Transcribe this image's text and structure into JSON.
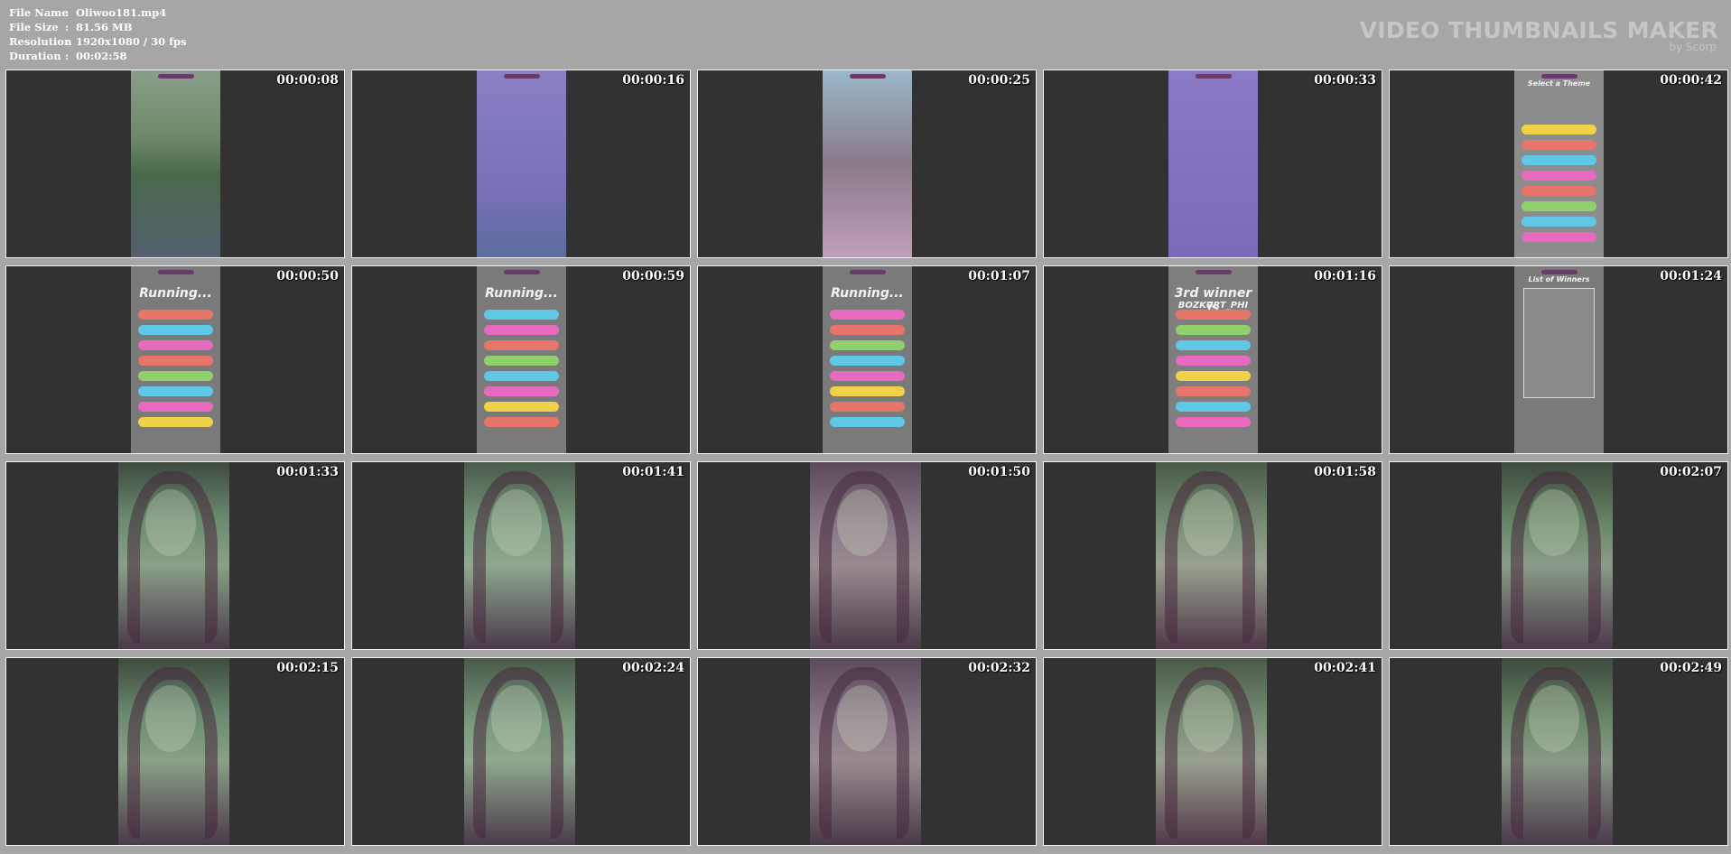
{
  "info": {
    "rows": [
      {
        "label": "File Name",
        "value": "Oliwoo181.mp4"
      },
      {
        "label": "File Size",
        "value": "81.56 MB"
      },
      {
        "label": "Resolution",
        "value": "1920x1080 / 30 fps"
      },
      {
        "label": "Duration",
        "value": "00:02:58"
      }
    ],
    "separator": ":"
  },
  "brand": {
    "title": "VIDEO THUMBNAILS MAKER",
    "subtitle": "by Scorp"
  },
  "colors": {
    "background": "#a6a6a6",
    "cell": "#323232",
    "border": "#f2f2f2"
  },
  "thumbnails": [
    {
      "time": "00:00:08",
      "kind": "movie"
    },
    {
      "time": "00:00:16",
      "kind": "puzzle"
    },
    {
      "time": "00:00:25",
      "kind": "game-room"
    },
    {
      "time": "00:00:33",
      "kind": "app-promo"
    },
    {
      "time": "00:00:42",
      "kind": "theme-select",
      "caption": "Select a Theme"
    },
    {
      "time": "00:00:50",
      "kind": "running",
      "caption": "Running..."
    },
    {
      "time": "00:00:59",
      "kind": "running",
      "caption": "Running..."
    },
    {
      "time": "00:01:07",
      "kind": "running",
      "caption": "Running..."
    },
    {
      "time": "00:01:16",
      "kind": "winner",
      "caption": "3rd winner is",
      "caption2": "BOZKURT_PHI"
    },
    {
      "time": "00:01:24",
      "kind": "winners-list",
      "caption": "List of Winners"
    },
    {
      "time": "00:01:33",
      "kind": "face"
    },
    {
      "time": "00:01:41",
      "kind": "face"
    },
    {
      "time": "00:01:50",
      "kind": "face"
    },
    {
      "time": "00:01:58",
      "kind": "face"
    },
    {
      "time": "00:02:07",
      "kind": "face"
    },
    {
      "time": "00:02:15",
      "kind": "face"
    },
    {
      "time": "00:02:24",
      "kind": "face"
    },
    {
      "time": "00:02:32",
      "kind": "face"
    },
    {
      "time": "00:02:41",
      "kind": "face"
    },
    {
      "time": "00:02:49",
      "kind": "face"
    }
  ]
}
